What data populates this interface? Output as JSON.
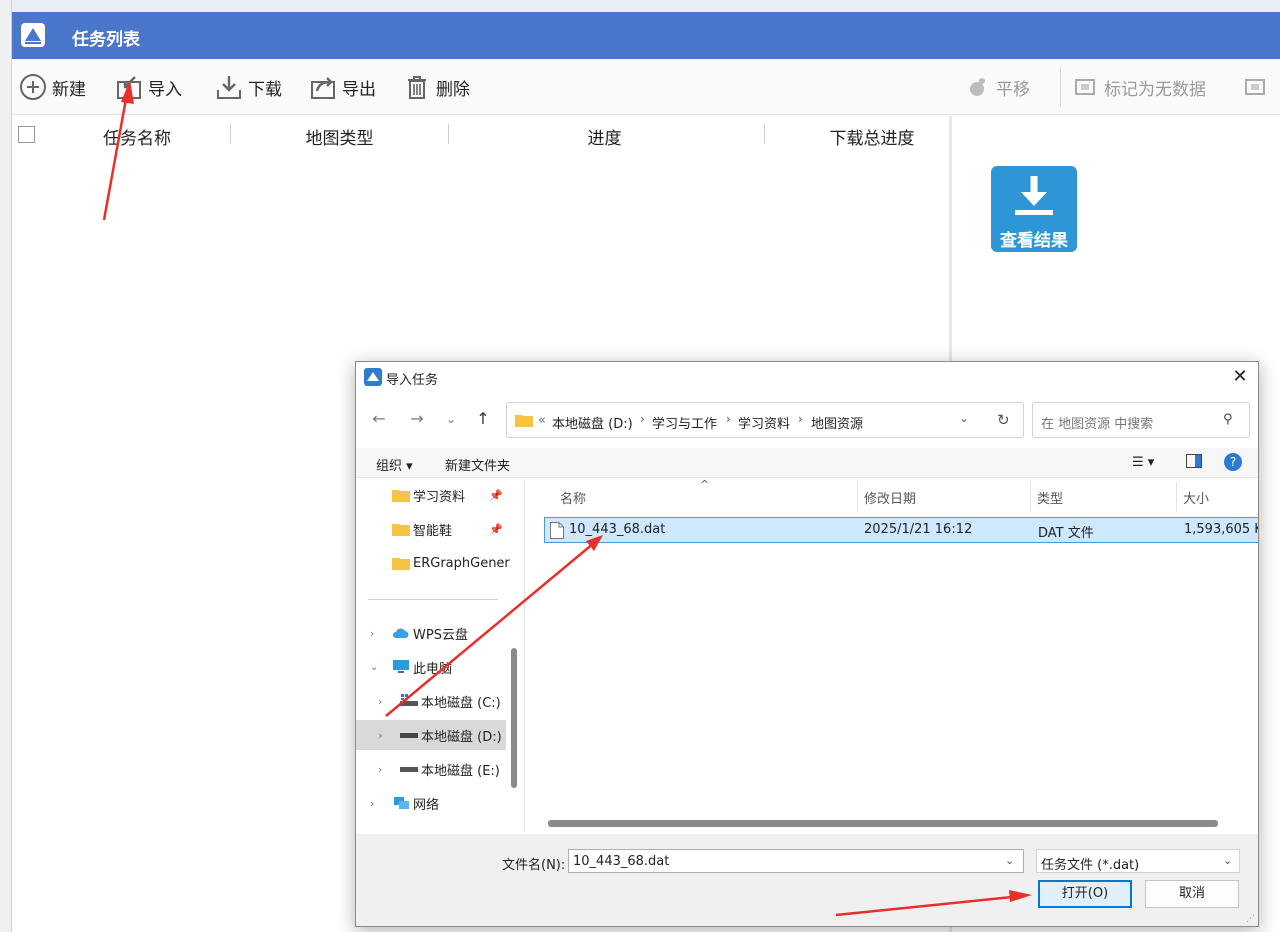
{
  "app": {
    "title": "任务列表",
    "toolbar": {
      "new_label": "新建",
      "import_label": "导入",
      "download_label": "下载",
      "export_label": "导出",
      "delete_label": "删除",
      "pan_label": "平移",
      "mark_nodata_label": "标记为无数据"
    },
    "table": {
      "columns": [
        "任务名称",
        "地图类型",
        "进度",
        "下载总进度"
      ]
    },
    "right_panel": {
      "view_result_label": "查看结果"
    }
  },
  "dialog": {
    "title": "导入任务",
    "breadcrumb": {
      "overflow": "«",
      "parts": [
        "本地磁盘 (D:)",
        "学习与工作",
        "学习资料",
        "地图资源"
      ]
    },
    "search_placeholder": "在 地图资源 中搜索",
    "commands": {
      "organize": "组织",
      "new_folder": "新建文件夹"
    },
    "nav_pane": {
      "quick_access": [
        "学习资料",
        "智能鞋",
        "ERGraphGener"
      ],
      "tree": [
        "WPS云盘",
        "此电脑",
        "本地磁盘 (C:)",
        "本地磁盘 (D:)",
        "本地磁盘 (E:)",
        "网络"
      ]
    },
    "file_columns": [
      "名称",
      "修改日期",
      "类型",
      "大小"
    ],
    "files": [
      {
        "name": "10_443_68.dat",
        "modified": "2025/1/21 16:12",
        "type": "DAT 文件",
        "size": "1,593,605 K"
      }
    ],
    "filename_label": "文件名(N):",
    "filename_value": "10_443_68.dat",
    "filetype_value": "任务文件 (*.dat)",
    "open_label": "打开(O)",
    "cancel_label": "取消"
  },
  "colors": {
    "titlebar": "#4a77c9",
    "view_result": "#2e96d5",
    "selection": "#cde8ff",
    "annotation_arrow": "#e8302a"
  }
}
